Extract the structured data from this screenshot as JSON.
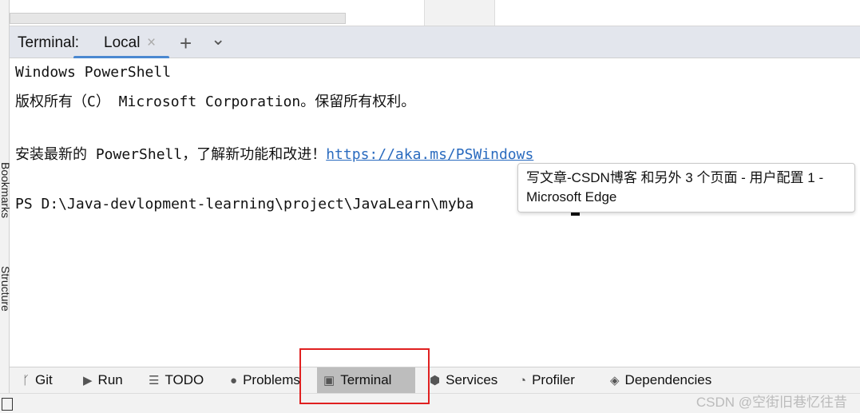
{
  "side": {
    "bookmarks": "Bookmarks",
    "structure": "Structure"
  },
  "terminal": {
    "label": "Terminal:",
    "tab": "Local",
    "close": "×",
    "add": "+",
    "dropdown": "⌄",
    "lines": [
      "Windows PowerShell",
      "版权所有（C） Microsoft Corporation。保留所有权利。",
      "安装最新的 PowerShell，了解新功能和改进！",
      "PS D:\\Java-devlopment-learning\\project\\JavaLearn\\myba"
    ],
    "link": "https://aka.ms/PSWindows"
  },
  "tooltip": {
    "line1": "写文章-CSDN博客 和另外 3 个页面 - 用户配置 1 -",
    "line2": "Microsoft Edge"
  },
  "toolbar": [
    {
      "label": "Git",
      "icon": "git-branch-icon"
    },
    {
      "label": "Run",
      "icon": "play-icon"
    },
    {
      "label": "TODO",
      "icon": "list-icon"
    },
    {
      "label": "Problems",
      "icon": "alert-icon"
    },
    {
      "label": "Terminal",
      "icon": "terminal-icon",
      "active": true
    },
    {
      "label": "Services",
      "icon": "services-icon"
    },
    {
      "label": "Profiler",
      "icon": "profiler-icon"
    },
    {
      "label": "Dependencies",
      "icon": "layers-icon"
    }
  ],
  "watermark": "CSDN @空街旧巷忆往昔",
  "colors": {
    "highlight": "#e02020",
    "link": "#2a6bbf",
    "tab_underline": "#4a88d0"
  }
}
